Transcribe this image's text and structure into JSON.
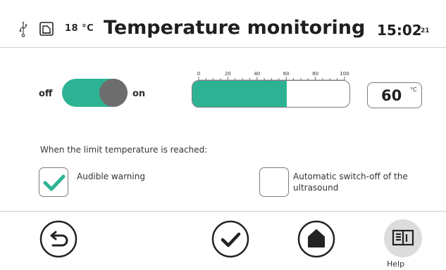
{
  "header": {
    "usb_icon": "usb-icon",
    "card_icon": "sd-card-icon",
    "device_temperature": "18 °C",
    "title": "Temperature monitoring",
    "time": "15:02",
    "seconds": "21"
  },
  "toggle": {
    "off_label": "off",
    "on_label": "on",
    "state": "on",
    "color": "#2db394"
  },
  "gauge": {
    "scale_min": 0,
    "scale_max": 100,
    "tick_labels": [
      "0",
      "20",
      "40",
      "60",
      "80",
      "100"
    ],
    "value": 60,
    "fill_color": "#2db394"
  },
  "limit": {
    "value": "60",
    "unit": "°C"
  },
  "options": {
    "heading": "When the limit temperature is reached:",
    "audible_warning": {
      "label": "Audible warning",
      "checked": true
    },
    "auto_switch_off": {
      "label_line1": "Automatic switch-off of the",
      "label_line2": "ultrasound",
      "checked": false
    }
  },
  "footer": {
    "back_icon": "back-arrow-icon",
    "confirm_icon": "checkmark-icon",
    "home_icon": "home-icon",
    "help_icon": "book-icon",
    "help_label": "Help"
  }
}
